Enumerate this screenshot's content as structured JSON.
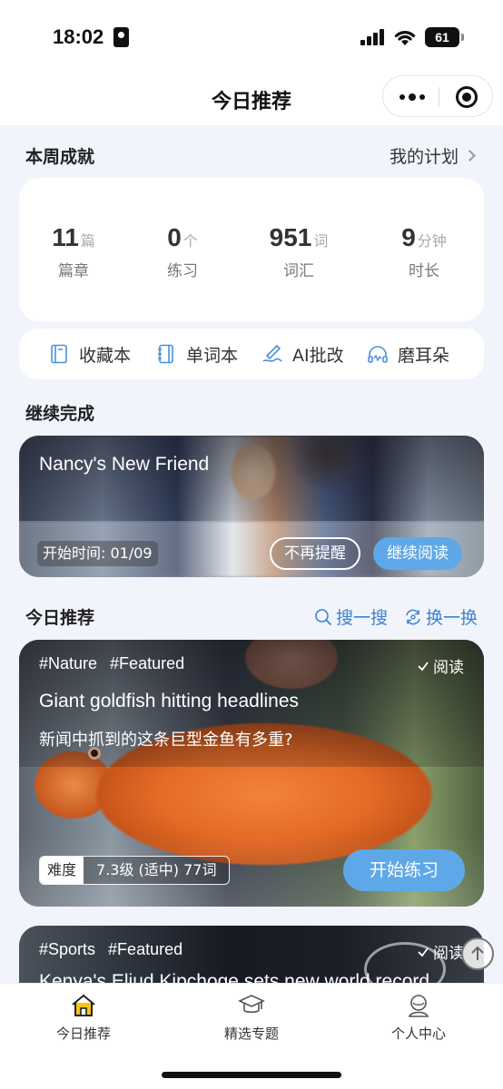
{
  "status": {
    "time": "18:02",
    "battery": "61"
  },
  "nav": {
    "title": "今日推荐"
  },
  "week": {
    "title": "本周成就",
    "plan_link": "我的计划",
    "stats": [
      {
        "num": "11",
        "unit": "篇",
        "label": "篇章"
      },
      {
        "num": "0",
        "unit": "个",
        "label": "练习"
      },
      {
        "num": "951",
        "unit": "词",
        "label": "词汇"
      },
      {
        "num": "9",
        "unit": "分钟",
        "label": "时长"
      }
    ]
  },
  "tools": [
    {
      "label": "收藏本",
      "icon": "bookmark-book-icon"
    },
    {
      "label": "单词本",
      "icon": "notebook-icon"
    },
    {
      "label": "AI批改",
      "icon": "pen-icon"
    },
    {
      "label": "磨耳朵",
      "icon": "headphones-icon"
    }
  ],
  "continue": {
    "title": "继续完成",
    "card_title": "Nancy's New Friend",
    "start_time": "开始时间: 01/09",
    "dismiss_label": "不再提醒",
    "resume_label": "继续阅读"
  },
  "today": {
    "title": "今日推荐",
    "search_label": "搜一搜",
    "shuffle_label": "换一换",
    "cards": [
      {
        "tags": [
          "#Nature",
          "#Featured"
        ],
        "read_label": "阅读",
        "title": "Giant goldfish hitting headlines",
        "subtitle": "新闻中抓到的这条巨型金鱼有多重?",
        "difficulty_key": "难度",
        "difficulty_value": "7.3级 (适中) 77词",
        "action_label": "开始练习"
      },
      {
        "tags": [
          "#Sports",
          "#Featured"
        ],
        "read_label": "阅读",
        "title": "Kenya's Eliud Kipchoge sets new world record"
      }
    ]
  },
  "tabbar": {
    "items": [
      {
        "label": "今日推荐",
        "icon": "home-icon"
      },
      {
        "label": "精选专题",
        "icon": "graduation-cap-icon"
      },
      {
        "label": "个人中心",
        "icon": "user-icon"
      }
    ]
  }
}
